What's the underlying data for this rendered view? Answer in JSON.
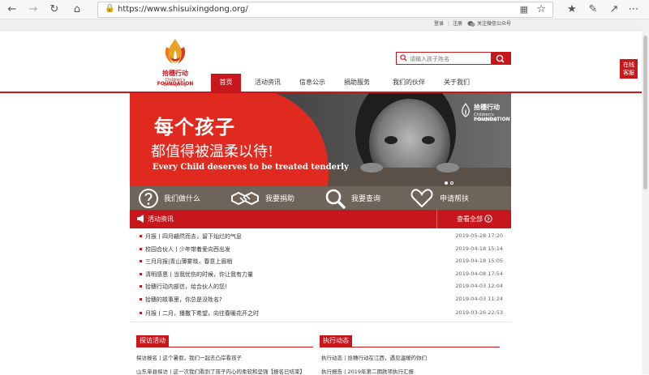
{
  "browser": {
    "url": "https://www.shisuixingdong.org/"
  },
  "util": {
    "login": "登录",
    "register": "注册",
    "wechat": "关注微信公众号"
  },
  "logo": {
    "cn": "拾穗行动",
    "en_small": "Children's Emergency",
    "en_big": "FOUNDATION"
  },
  "search": {
    "placeholder": "请输入孩子姓名"
  },
  "nav": [
    "首页",
    "活动资讯",
    "信息公示",
    "捐助服务",
    "我们的伙伴",
    "关于我们"
  ],
  "side_service": [
    "在线",
    "客服"
  ],
  "banner": {
    "line1": "每个孩子",
    "line2": "都值得被温柔以待!",
    "line3": "Every Child deserves to be treated tenderly",
    "logo_cn": "拾穗行动",
    "logo_en_small": "Children's Emergency",
    "logo_en_big": "FOUNDATION"
  },
  "quick": [
    "我们做什么",
    "我要捐助",
    "我要查询",
    "申请帮扶"
  ],
  "news_header": {
    "title": "活动资讯",
    "more": "查看全部"
  },
  "news": [
    {
      "title": "月报丨四月翩然而去，留下灿烂的气息",
      "date": "2019-05-28 17:20"
    },
    {
      "title": "校园合伙人丨少年带着爱向西出发",
      "date": "2019-04-18 15:14"
    },
    {
      "title": "三月月报|青山薄雾晓，春意上眉梢",
      "date": "2019-04-18 15:05"
    },
    {
      "title": "清明感恩丨当我忧伤的时候，你让我有力量",
      "date": "2019-04-08 17:54"
    },
    {
      "title": "拾穗行动内部信，给合伙人的您!",
      "date": "2019-04-03 12:04"
    },
    {
      "title": "拾穗的故事里，你总是没姓名?",
      "date": "2019-04-03 11:24"
    },
    {
      "title": "月报丨二月，播撒下希望，向往春暖花开之时",
      "date": "2019-03-26 22:53"
    }
  ],
  "section_left": {
    "title": "探访活动",
    "items": [
      "探访报名丨这个暑假，我们一起去凸岸看孩子",
      "山东单县探访丨这一次我们看到了孩子内心的柔软和坚强【报名已结束】"
    ]
  },
  "section_right": {
    "title": "执行动态",
    "items": [
      "执行动态丨拾穗行动在江西，遇见温暖的你们",
      "执行报告丨2019年第二期款项执行汇报"
    ]
  },
  "colors": {
    "brand_red": "#c8161d",
    "quick_bar": "#6e6459"
  }
}
